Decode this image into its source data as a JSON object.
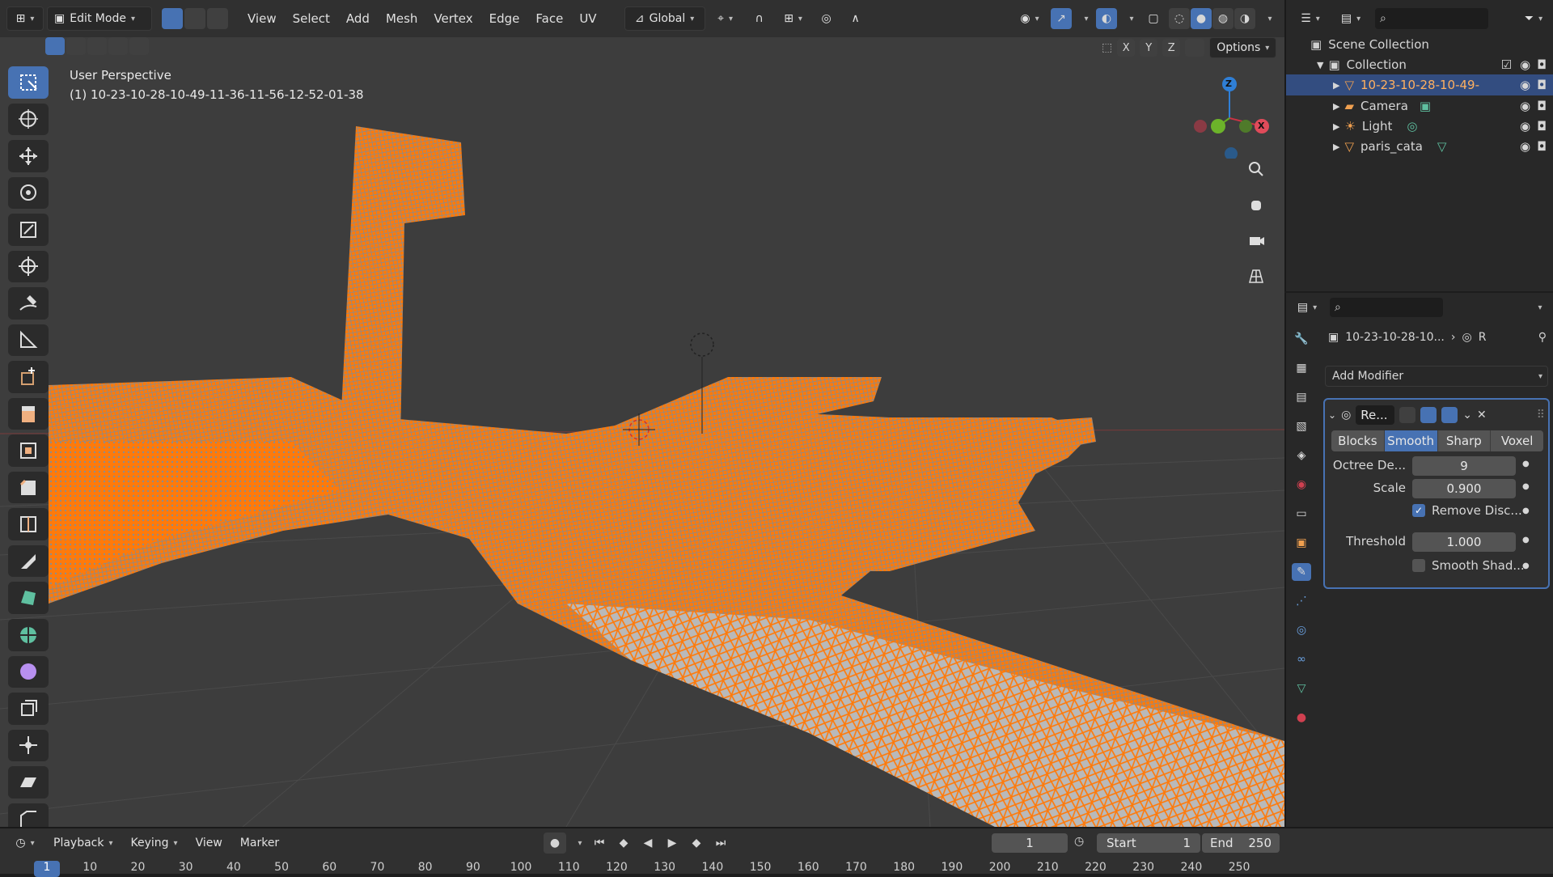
{
  "header": {
    "mode": "Edit Mode",
    "menus": [
      "View",
      "Select",
      "Add",
      "Mesh",
      "Vertex",
      "Edge",
      "Face",
      "UV"
    ],
    "transform_orientation": "Global",
    "options_label": "Options",
    "axis_x": "X",
    "axis_y": "Y",
    "axis_z": "Z"
  },
  "viewport": {
    "perspective_label": "User Perspective",
    "object_label": "(1) 10-23-10-28-10-49-11-36-11-56-12-52-01-38",
    "gizmo_z": "Z",
    "gizmo_x": "X",
    "gizmo_y": "Y"
  },
  "outliner": {
    "scene_collection": "Scene Collection",
    "collection": "Collection",
    "items": [
      {
        "label": "10-23-10-28-10-49-",
        "icon": "mesh-icon",
        "selected": true
      },
      {
        "label": "Camera",
        "icon": "camera-icon",
        "selected": false
      },
      {
        "label": "Light",
        "icon": "light-icon",
        "selected": false
      },
      {
        "label": "paris_cata",
        "icon": "mesh-icon",
        "selected": false
      }
    ]
  },
  "properties": {
    "object_name": "10-23-10-28-10...",
    "modifier_short": "R",
    "add_modifier": "Add Modifier",
    "modifier_name": "Re...",
    "modes": [
      "Blocks",
      "Smooth",
      "Sharp",
      "Voxel"
    ],
    "active_mode": "Smooth",
    "octree_label": "Octree De...",
    "octree_value": "9",
    "scale_label": "Scale",
    "scale_value": "0.900",
    "remove_label": "Remove Disc...",
    "threshold_label": "Threshold",
    "threshold_value": "1.000",
    "smooth_shade_label": "Smooth Shad..."
  },
  "timeline": {
    "playback": "Playback",
    "keying": "Keying",
    "view": "View",
    "marker": "Marker",
    "current_frame": "1",
    "start_label": "Start",
    "start_value": "1",
    "end_label": "End",
    "end_value": "250",
    "ticks": [
      "1",
      "10",
      "20",
      "30",
      "40",
      "50",
      "60",
      "70",
      "80",
      "90",
      "100",
      "110",
      "120",
      "130",
      "140",
      "150",
      "160",
      "170",
      "180",
      "190",
      "200",
      "210",
      "220",
      "230",
      "240",
      "250"
    ]
  },
  "colors": {
    "accent": "#4772b3",
    "mesh_selected": "#ff7a0a",
    "background": "#3d3d3d"
  }
}
